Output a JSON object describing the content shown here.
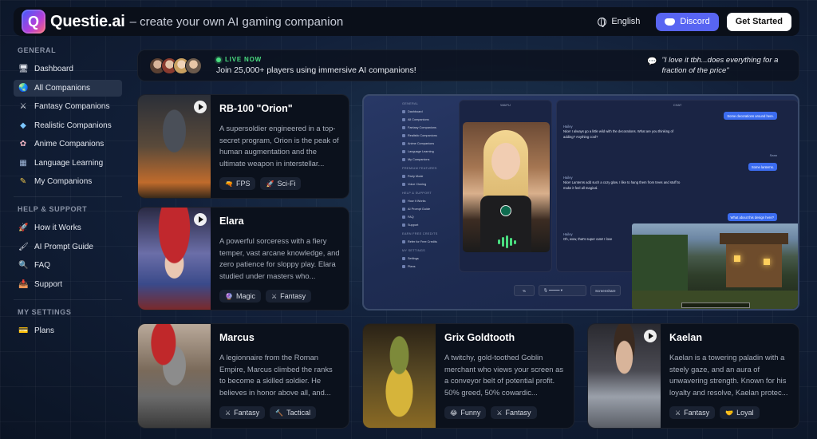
{
  "header": {
    "brand": "Questie.ai",
    "logo_letter": "Q",
    "tagline": "– create your own AI gaming companion",
    "language": "English",
    "discord_label": "Discord",
    "cta_label": "Get Started"
  },
  "sidebar": {
    "general_title": "GENERAL",
    "general_items": [
      {
        "label": "Dashboard",
        "icon": "monitor-icon"
      },
      {
        "label": "All Companions",
        "icon": "globe-icon"
      },
      {
        "label": "Fantasy Companions",
        "icon": "swords-icon"
      },
      {
        "label": "Realistic Companions",
        "icon": "diamond-icon"
      },
      {
        "label": "Anime Companions",
        "icon": "flower-icon"
      },
      {
        "label": "Language Learning",
        "icon": "translate-icon"
      },
      {
        "label": "My Companions",
        "icon": "pencil-icon"
      }
    ],
    "help_title": "HELP & SUPPORT",
    "help_items": [
      {
        "label": "How it Works",
        "icon": "rocket-icon"
      },
      {
        "label": "AI Prompt Guide",
        "icon": "brush-icon"
      },
      {
        "label": "FAQ",
        "icon": "magnifier-icon"
      },
      {
        "label": "Support",
        "icon": "mailbox-icon"
      }
    ],
    "settings_title": "MY SETTINGS",
    "settings_items": [
      {
        "label": "Plans",
        "icon": "card-icon"
      }
    ]
  },
  "live": {
    "tag": "LIVE NOW",
    "message": "Join 25,000+ players using immersive AI companions!",
    "quote": "\"I love it tbh...does everything for a fraction of the price\""
  },
  "cards": {
    "orion": {
      "title": "RB-100 \"Orion\"",
      "desc": "A supersoldier engineered in a top-secret program, Orion is the peak of human augmentation and the ultimate weapon in interstellar...",
      "tags": [
        "FPS",
        "Sci-Fi"
      ]
    },
    "elara": {
      "title": "Elara",
      "desc": "A powerful sorceress with a fiery temper, vast arcane knowledge, and zero patience for sloppy play. Elara studied under masters who...",
      "tags": [
        "Magic",
        "Fantasy"
      ]
    },
    "marcus": {
      "title": "Marcus",
      "desc": "A legionnaire from the Roman Empire, Marcus climbed the ranks to become a skilled soldier. He believes in honor above all, and...",
      "tags": [
        "Fantasy",
        "Tactical"
      ]
    },
    "grix": {
      "title": "Grix Goldtooth",
      "desc": "A twitchy, gold-toothed Goblin merchant who views your screen as a conveyor belt of potential profit. 50% greed, 50% cowardic...",
      "tags": [
        "Funny",
        "Fantasy"
      ]
    },
    "kaelan": {
      "title": "Kaelan",
      "desc": "Kaelan is a towering paladin with a steely gaze, and an aura of unwavering strength. Known for his loyalty and resolve, Kaelan protec...",
      "tags": [
        "Fantasy",
        "Loyal"
      ]
    }
  },
  "preview": {
    "sec_general": "GENERAL",
    "items_general": [
      "Dashboard",
      "All Companions",
      "Fantasy Companions",
      "Realistic Companions",
      "Anime Companions",
      "Language Learning",
      "My Companions"
    ],
    "sec_premium": "PREMIUM FEATURES",
    "items_premium": [
      "Party Mode",
      "Voice Cloning"
    ],
    "sec_help": "HELP & SUPPORT",
    "items_help": [
      "How It Works",
      "AI Prompt Guide",
      "FAQ",
      "Support"
    ],
    "sec_earn": "EARN FREE CREDITS",
    "items_earn": [
      "Refer for Free Credits"
    ],
    "sec_settings": "MY SETTINGS",
    "items_settings": [
      "Settings",
      "Plans"
    ],
    "waifu_title": "WAIFU",
    "chat_title": "CHAT",
    "msgs": {
      "m1": "Some decorations around here.",
      "m2": "Nice! I always go a little wild with the decorations. What are you thinking of adding? Anything cool?",
      "m3": "Some lanterns.",
      "m4": "Nice! Lanterns add such a cozy glow. I like to hang them from trees and stuff to make it feel all magical.",
      "m5": "What about this design here?",
      "m6": "Oh, wow, that's super cute! I love",
      "speaker": "Hailey",
      "you": "Sean"
    },
    "screenshare": "Screenshare"
  }
}
